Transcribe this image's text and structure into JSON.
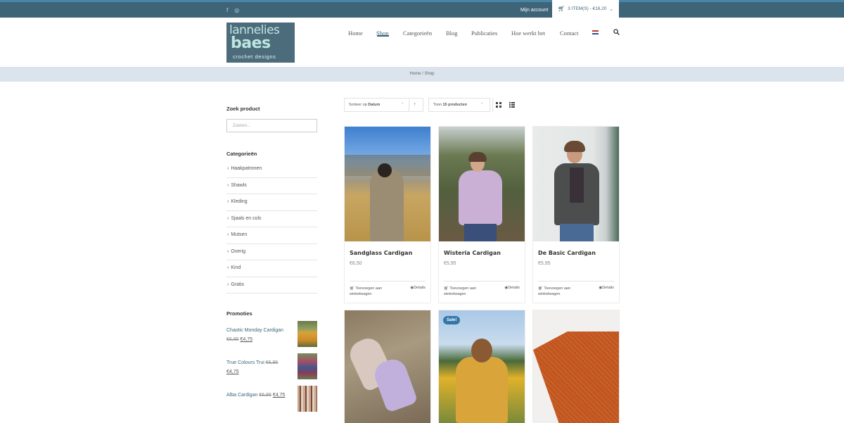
{
  "topbar": {
    "account": "Mijn account",
    "cart": "3 ITEM(S) - €16,20"
  },
  "logo": {
    "line1": "lannelies",
    "line2": "baes",
    "line3": "crochet designs"
  },
  "nav": [
    "Home",
    "Shop",
    "Categorieën",
    "Blog",
    "Publicaties",
    "Hoe werkt het",
    "Contact"
  ],
  "breadcrumb": {
    "home": "Home",
    "sep": "/",
    "current": "Shop"
  },
  "sidebar": {
    "search_title": "Zoek product",
    "search_placeholder": "Zoeken...",
    "categories_title": "Categorieën",
    "categories": [
      "Haakpatronen",
      "Shawls",
      "Kleding",
      "Sjaals en cols",
      "Mutsen",
      "Overig",
      "Kind",
      "Gratis"
    ],
    "promos_title": "Promoties",
    "promos": [
      {
        "name": "Chaotic Monday Cardigan",
        "old": "€6,95",
        "new": "€4,75"
      },
      {
        "name": "True Colours Trui",
        "old": "€6,95",
        "new": "€4,75"
      },
      {
        "name": "Alba Cardigan",
        "old": "€6,95",
        "new": "€4,75"
      }
    ]
  },
  "toolbar": {
    "sort_prefix": "Sorteer op",
    "sort_value": "Datum",
    "show_prefix": "Toon",
    "show_value": "15 producten"
  },
  "products": [
    {
      "name": "Sandglass Cardigan",
      "price": "€6,50",
      "add": "Toevoegen aan winkelwagen",
      "details": "Details"
    },
    {
      "name": "Wisteria Cardigan",
      "price": "€5,95",
      "add": "Toevoegen aan winkelwagen",
      "details": "Details"
    },
    {
      "name": "De Basic Cardigan",
      "price": "€5,95",
      "add": "Toevoegen aan winkelwagen",
      "details": "Details"
    }
  ],
  "sale_badge": "Sale!",
  "colors": {
    "accent": "#3e6478",
    "topbar": "#3e6478",
    "crumbbar": "#dbe3ec",
    "sale": "#3277a8"
  }
}
